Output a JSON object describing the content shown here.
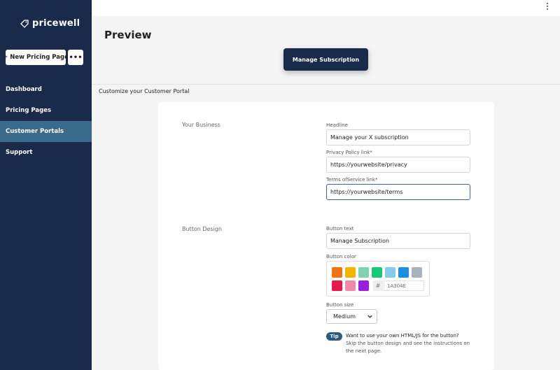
{
  "sidebar": {
    "logo_text": "pricewell",
    "new_button_label": "+ New Pricing Page",
    "more_button_label": "•••",
    "nav": [
      {
        "label": "Dashboard",
        "active": false
      },
      {
        "label": "Pricing Pages",
        "active": false
      },
      {
        "label": "Customer Portals",
        "active": true
      },
      {
        "label": "Support",
        "active": false
      }
    ]
  },
  "topbar": {
    "menu_icon": "kebab-menu-icon"
  },
  "preview": {
    "title": "Preview",
    "button_label": "Manage Subscription"
  },
  "customize": {
    "heading": "Customize your Customer Portal",
    "business": {
      "section_title": "Your Business",
      "headline_label": "Headline",
      "headline_value": "Manage your X subscription",
      "privacy_label": "Privacy Policy link*",
      "privacy_value": "https://yourwebsite/privacy",
      "terms_label": "Terms ofService link*",
      "terms_value": "https://yourwebsite/terms"
    },
    "button_design": {
      "section_title": "Button Design",
      "text_label": "Button text",
      "text_value": "Manage Subscription",
      "color_label": "Button color",
      "swatches": [
        "#f47216",
        "#f5b400",
        "#7ed3b3",
        "#19c77a",
        "#84ccec",
        "#1a8fe0",
        "#a7b2bd",
        "#e6194b",
        "#f08aa8",
        "#9b1ee0"
      ],
      "hash_symbol": "#",
      "hex_value": "1A304E",
      "size_label": "Button size",
      "size_value": "Medium",
      "tip_badge": "Tip",
      "tip_line1": "Want to use your own HTML/JS for the button?",
      "tip_line2": "Skip the button design and see the instructions on",
      "tip_line3": "the next page."
    }
  },
  "colors": {
    "sidebar_bg": "#1a2a4a",
    "active_nav": "#3a6a8c",
    "primary_button": "#1a2a4a"
  }
}
